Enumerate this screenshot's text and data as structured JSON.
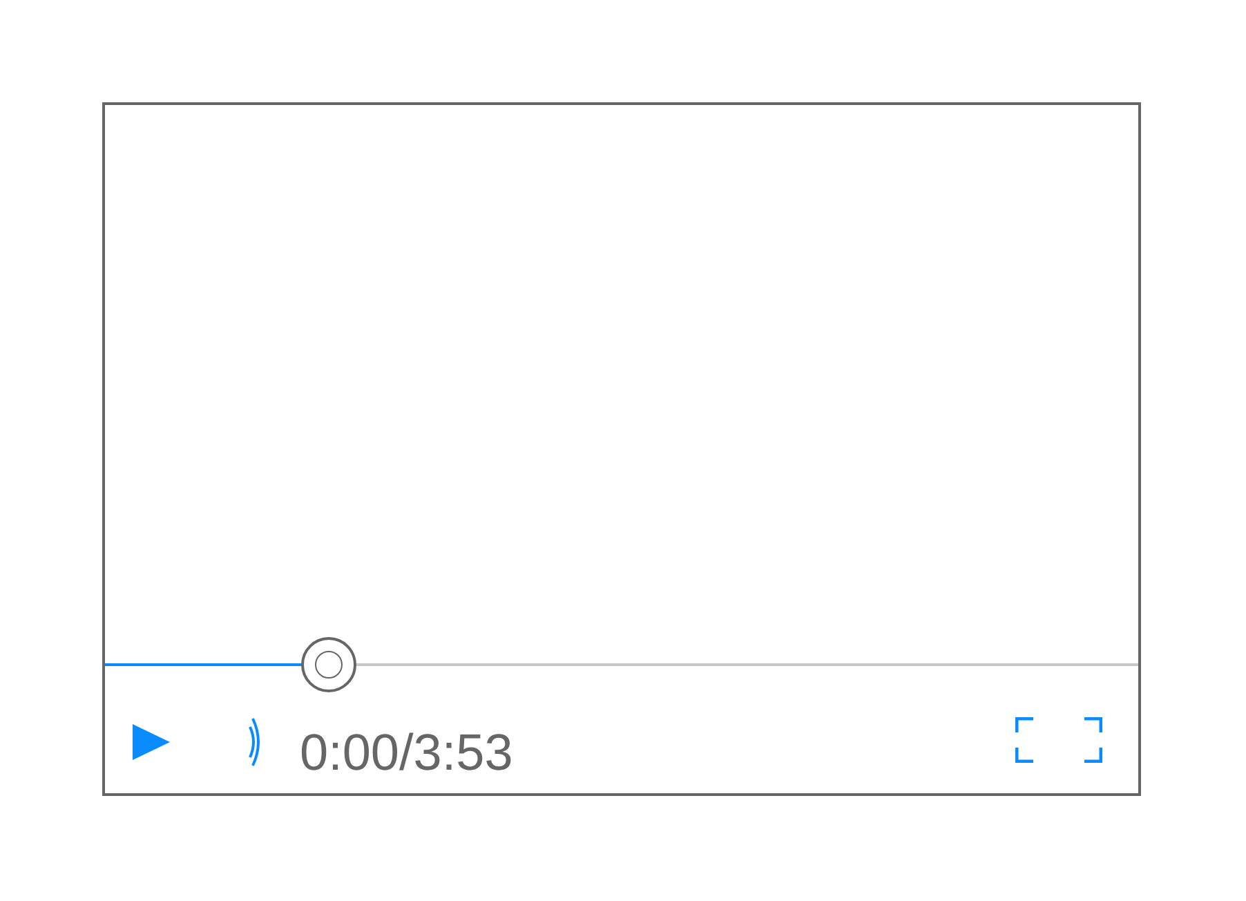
{
  "player": {
    "progress": {
      "level": 0.216
    },
    "time": "0:00/3:53"
  }
}
